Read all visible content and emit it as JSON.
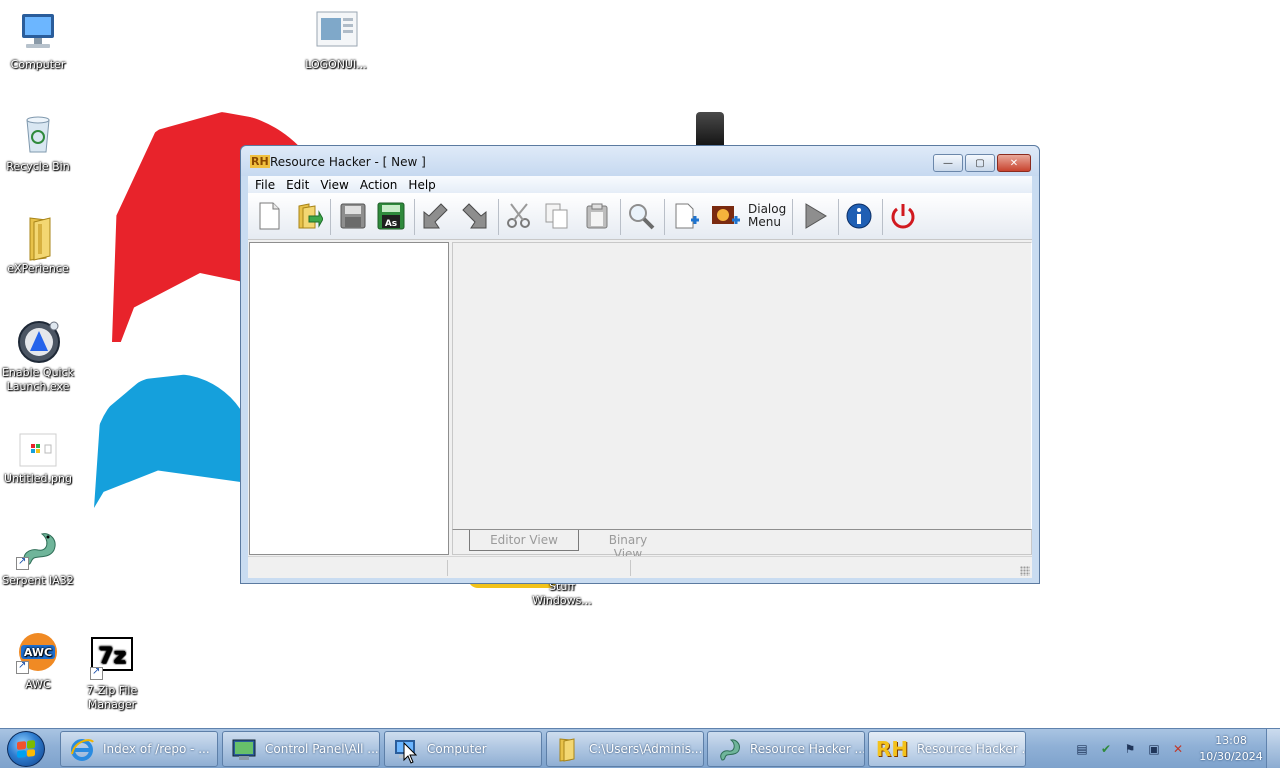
{
  "desktop": {
    "icons": [
      {
        "label": "Computer"
      },
      {
        "label": "Recycle Bin"
      },
      {
        "label": "eXPerience"
      },
      {
        "label": "Enable Quick Launch.exe"
      },
      {
        "label": "Untitled.png"
      },
      {
        "label": "Serpent IA32"
      },
      {
        "label": "AWC"
      },
      {
        "label": "7-Zip File Manager"
      },
      {
        "label": "LOGONUI..."
      },
      {
        "label": "Stuff Windows..."
      }
    ],
    "awc_badge": "AWC",
    "sevenzip_badge": "7z"
  },
  "window": {
    "title": "Resource Hacker - [ New ]",
    "app_badge": "RH",
    "controls": {
      "minimize": "—",
      "maximize": "▢",
      "close": "✕"
    },
    "menu": [
      "File",
      "Edit",
      "View",
      "Action",
      "Help"
    ],
    "toolbar": {
      "tools": [
        {
          "icon": "new-file-icon"
        },
        {
          "icon": "open-file-icon"
        },
        {
          "icon": "save-icon"
        },
        {
          "icon": "save-as-icon",
          "text": "As"
        },
        {
          "icon": "back-icon"
        },
        {
          "icon": "forward-icon"
        },
        {
          "icon": "cut-icon"
        },
        {
          "icon": "copy-icon"
        },
        {
          "icon": "paste-icon"
        },
        {
          "icon": "find-icon"
        },
        {
          "icon": "add-resource-icon"
        },
        {
          "icon": "add-image-icon"
        },
        {
          "icon": "dialog-menu-icon",
          "text_line1": "Dialog",
          "text_line2": "Menu"
        },
        {
          "icon": "compile-run-icon"
        },
        {
          "icon": "info-icon"
        },
        {
          "icon": "power-icon"
        }
      ]
    },
    "tabs": {
      "editor": "Editor View",
      "binary": "Binary View"
    }
  },
  "taskbar": {
    "items": [
      {
        "label": "Index of /repo - ...",
        "icon": "internet-explorer-icon"
      },
      {
        "label": "Control Panel\\All ...",
        "icon": "control-panel-icon"
      },
      {
        "label": "Computer",
        "icon": "computer-icon"
      },
      {
        "label": "C:\\Users\\Adminis...",
        "icon": "folder-icon"
      },
      {
        "label": "Resource Hacker ...",
        "icon": "serpent-icon"
      },
      {
        "label": "Resource Hacker ...",
        "icon": "resource-hacker-icon"
      }
    ],
    "rh_badge": "RH",
    "clock": {
      "time": "13:08",
      "date": "10/30/2024"
    }
  },
  "colors": {
    "accent": "#c9dcf1",
    "taskbar": "#8fb0d6",
    "close_button": "#c8432e"
  }
}
